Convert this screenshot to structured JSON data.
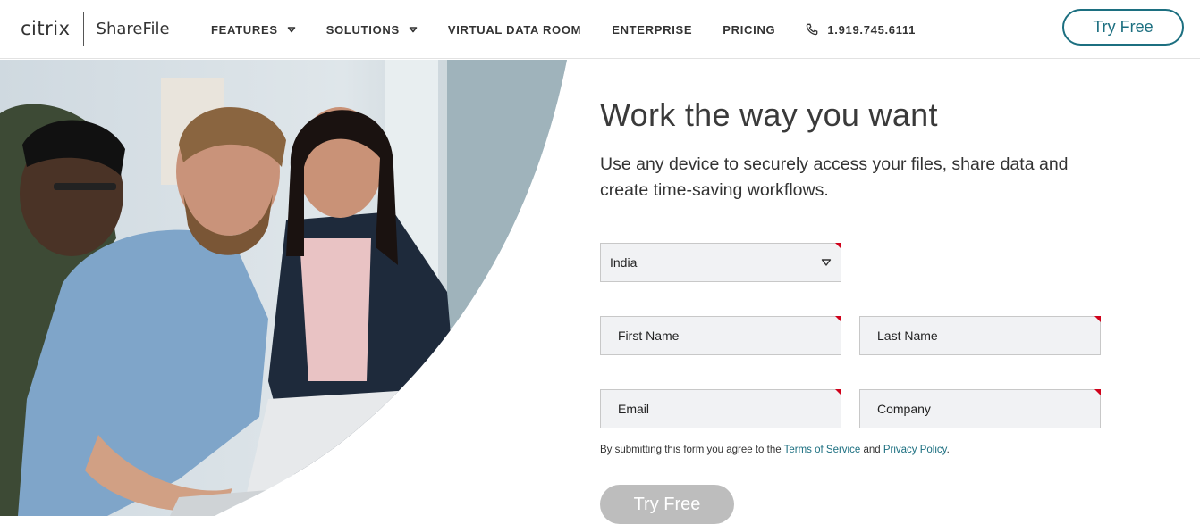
{
  "header": {
    "brand": {
      "citrix": "citrix",
      "product": "ShareFile"
    },
    "nav": [
      {
        "label": "FEATURES",
        "has_dropdown": true
      },
      {
        "label": "SOLUTIONS",
        "has_dropdown": true
      },
      {
        "label": "VIRTUAL DATA ROOM",
        "has_dropdown": false
      },
      {
        "label": "ENTERPRISE",
        "has_dropdown": false
      },
      {
        "label": "PRICING",
        "has_dropdown": false
      }
    ],
    "phone": {
      "icon": "phone-icon",
      "label": "1.919.745.6111"
    },
    "cta_label": "Try Free"
  },
  "hero": {
    "image_semantic": "team-working-at-laptop-photo"
  },
  "main": {
    "headline": "Work the way you want",
    "subtext": "Use any device to securely access your files, share data and create time-saving workflows."
  },
  "form": {
    "country": {
      "value": "India"
    },
    "first_name": {
      "placeholder": "First Name"
    },
    "last_name": {
      "placeholder": "Last Name"
    },
    "email": {
      "placeholder": "Email"
    },
    "company": {
      "placeholder": "Company"
    },
    "consent": {
      "prefix": "By submitting this form you agree to the ",
      "terms_link": "Terms of Service",
      "middle": " and ",
      "privacy_link": "Privacy Policy",
      "suffix": "."
    },
    "submit_label": "Try Free"
  },
  "colors": {
    "accent": "#1c6f80",
    "required_marker": "#d0021b",
    "field_bg": "#f1f2f4",
    "submit_disabled": "#bdbdbd"
  }
}
